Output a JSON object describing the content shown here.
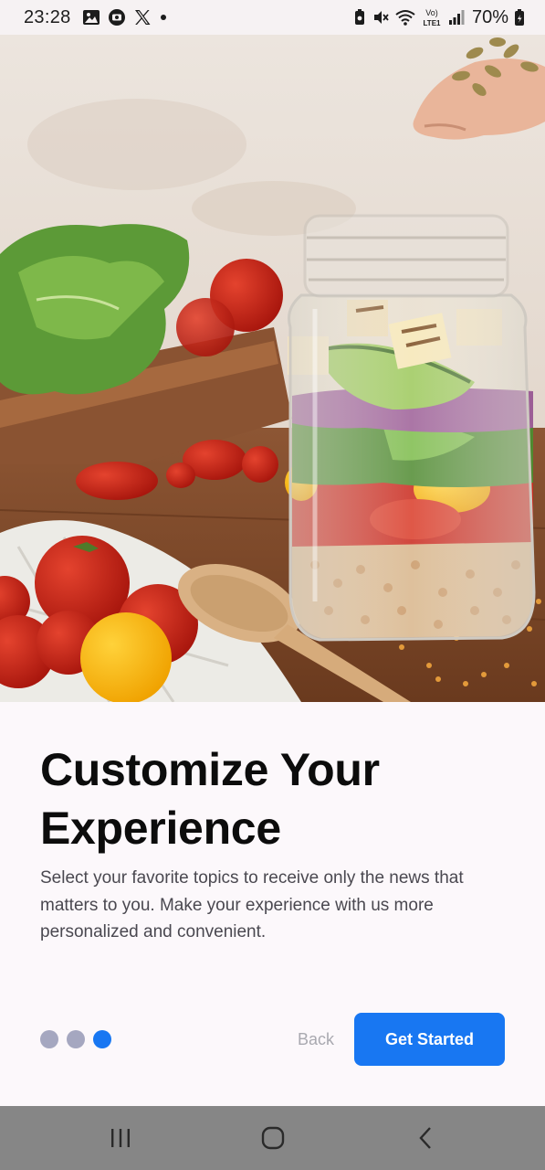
{
  "status_bar": {
    "time": "23:28",
    "battery": "70%",
    "left_icons": [
      "gallery-icon",
      "screen-record-icon",
      "x-app-icon",
      "notification-dot-icon"
    ],
    "right_icons": [
      "battery-saver-icon",
      "mute-icon",
      "wifi-icon",
      "volte-lte-icon",
      "signal-icon",
      "battery-icon"
    ],
    "volte_top": "Vo)",
    "volte_bottom": "LTE1"
  },
  "onboarding": {
    "title": "Customize Your Experience",
    "description": "Select your favorite topics to receive only the news that matters to you. Make your experience with us more personalized and convenient.",
    "page_index": 3,
    "page_count": 3,
    "back_label": "Back",
    "get_started_label": "Get Started"
  },
  "nav_bar": {
    "buttons": [
      "recent-apps-icon",
      "home-icon",
      "back-icon"
    ]
  },
  "colors": {
    "accent": "#1877f2",
    "dot_inactive": "#a5a7c0",
    "back_text": "#a9a9b0",
    "background": "#fcf8fb",
    "nav_bar": "#868686"
  }
}
